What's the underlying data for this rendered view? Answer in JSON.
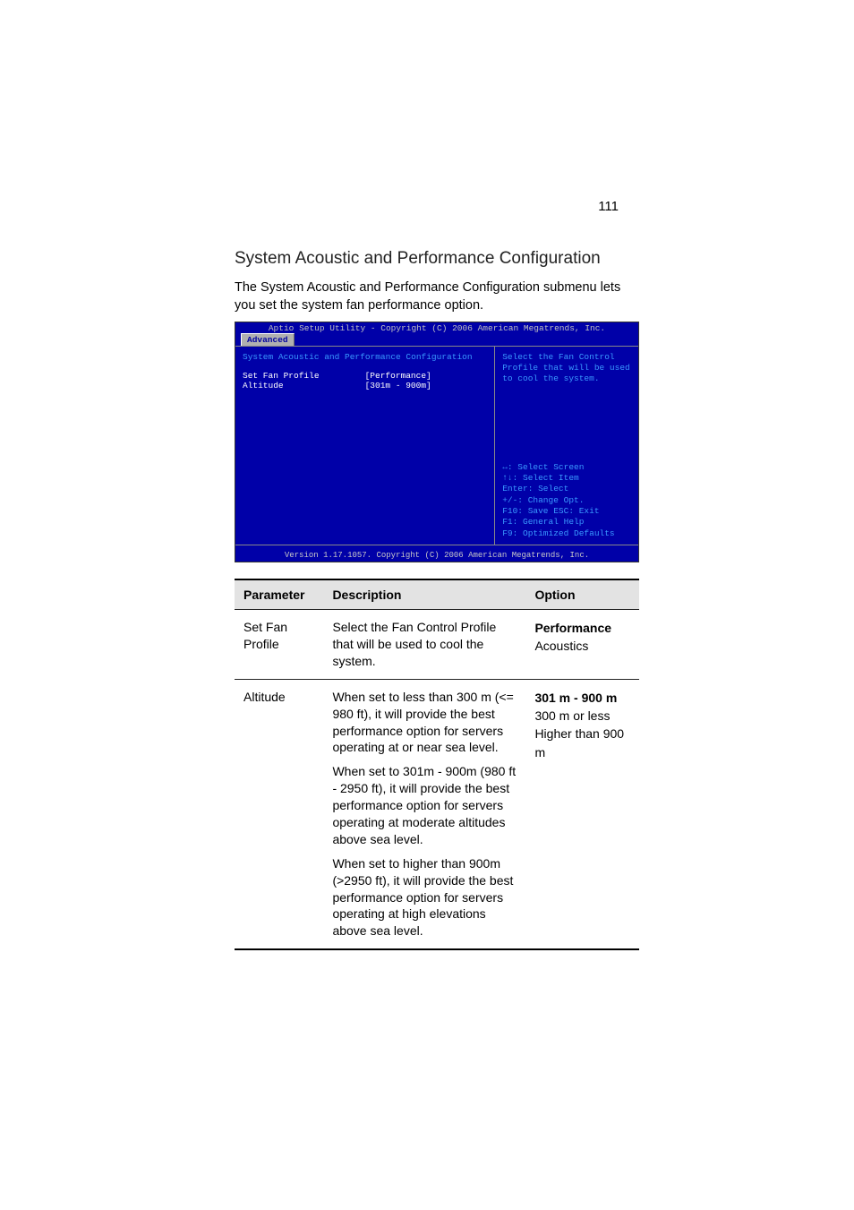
{
  "page_number": "111",
  "section_heading": "System Acoustic and Performance Configuration",
  "intro_paragraph": "The System Acoustic and Performance Configuration submenu lets you set the system fan performance option.",
  "bios": {
    "title": "Aptio Setup Utility - Copyright (C) 2006 American Megatrends, Inc.",
    "tab": "Advanced",
    "subtitle": "System Acoustic and Performance Configuration",
    "rows": [
      {
        "label": "Set Fan Profile",
        "value": "[Performance]"
      },
      {
        "label": "Altitude",
        "value": "[301m - 900m]"
      }
    ],
    "help_text": "Select the Fan Control Profile that will be used to cool the system.",
    "keys": [
      "↔: Select Screen",
      "↑↓: Select Item",
      "Enter: Select",
      "+/-: Change Opt.",
      "F10: Save  ESC: Exit",
      "F1: General Help",
      "F9: Optimized Defaults"
    ],
    "footer": "Version 1.17.1057. Copyright (C) 2006 American Megatrends, Inc."
  },
  "table": {
    "headers": {
      "parameter": "Parameter",
      "description": "Description",
      "option": "Option"
    },
    "rows": [
      {
        "parameter": "Set Fan Profile",
        "description_paras": [
          "Select the Fan Control Profile that will be used to cool the system."
        ],
        "options": [
          {
            "text": "Performance",
            "bold": true
          },
          {
            "text": "Acoustics",
            "bold": false
          }
        ]
      },
      {
        "parameter": "Altitude",
        "description_paras": [
          "When set to less than 300 m (<= 980 ft), it will provide the best performance option for servers operating at or near sea level.",
          "When set to 301m - 900m (980 ft - 2950 ft), it will provide the best performance option for servers operating at moderate altitudes above sea level.",
          "When set to higher than 900m (>2950 ft), it will provide the best performance option for servers operating at high elevations above sea level."
        ],
        "options": [
          {
            "text": "301 m - 900 m",
            "bold": true
          },
          {
            "text": "300 m or less",
            "bold": false
          },
          {
            "text": "Higher than 900 m",
            "bold": false
          }
        ]
      }
    ]
  }
}
